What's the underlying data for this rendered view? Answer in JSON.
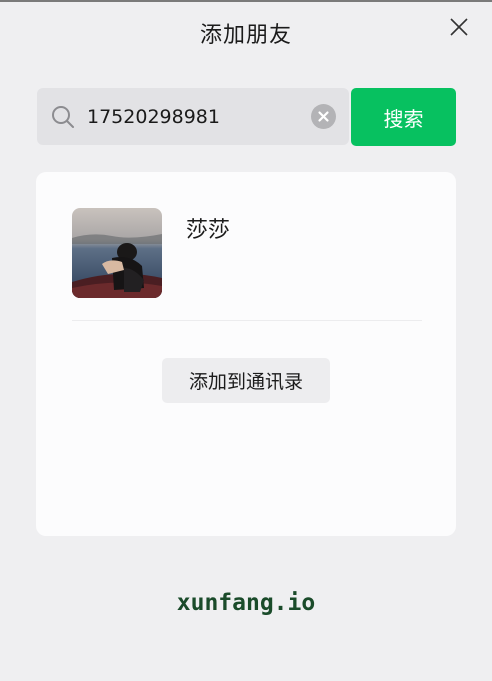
{
  "window": {
    "title": "添加朋友"
  },
  "icons": {
    "close": "close-icon",
    "search": "search-icon",
    "clear": "clear-icon"
  },
  "search": {
    "value": "17520298981",
    "button_label": "搜索"
  },
  "result": {
    "name": "莎莎",
    "add_label": "添加到通讯录"
  },
  "watermark": "xunfang.io",
  "colors": {
    "accent": "#07C160",
    "background": "#EFEFF1",
    "card": "#FCFCFD"
  }
}
